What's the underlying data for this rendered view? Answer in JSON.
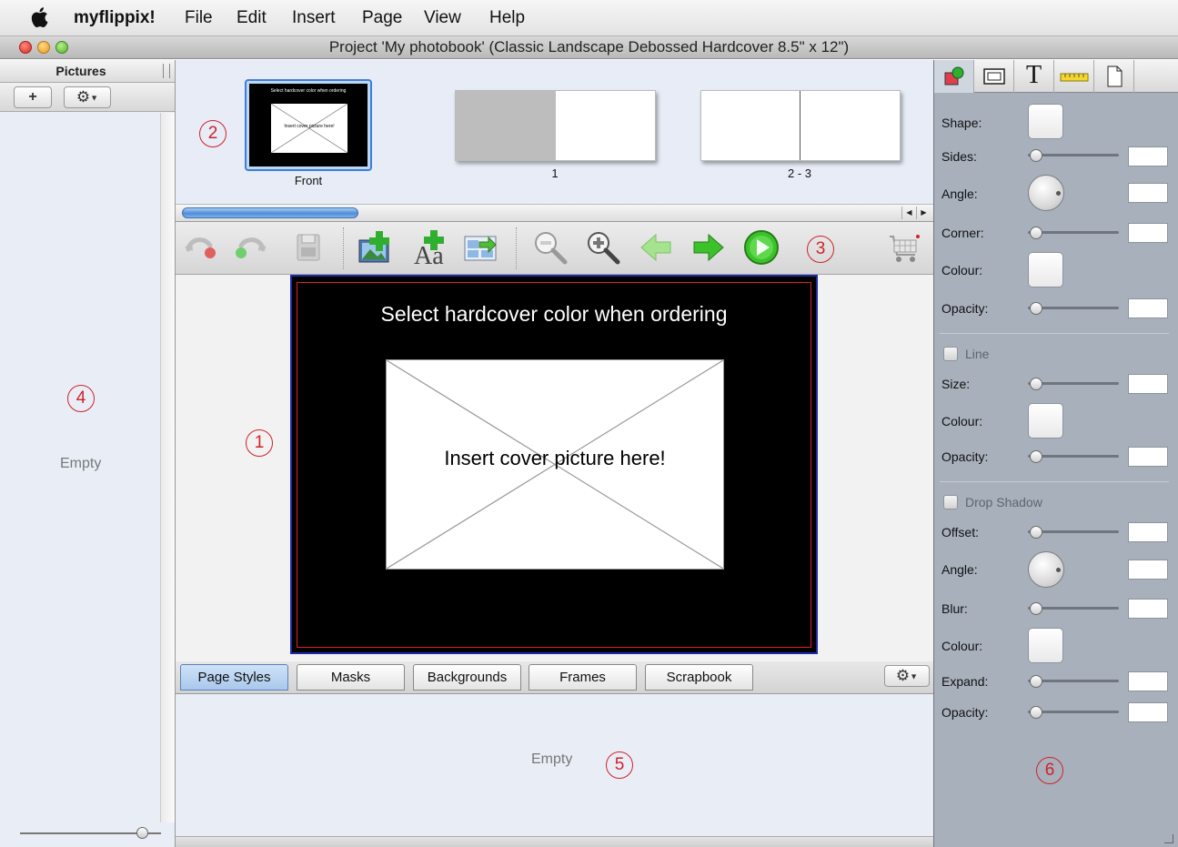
{
  "menubar": {
    "apple_icon": "apple-icon",
    "app_name": "myflippix!",
    "items": [
      "File",
      "Edit",
      "Insert",
      "Page",
      "View",
      "Help"
    ]
  },
  "window": {
    "title": "Project 'My photobook' (Classic Landscape Debossed Hardcover 8.5\" x 12\")"
  },
  "pictures_panel": {
    "header": "Pictures",
    "add_label": "+",
    "empty_text": "Empty",
    "callout": "4"
  },
  "thumbnails": {
    "callout": "2",
    "items": [
      {
        "label": "Front",
        "mini_title": "Select hardcover color when ordering",
        "mini_text": "Insert cover picture here!"
      },
      {
        "label": "1"
      },
      {
        "label": "2 - 3"
      }
    ]
  },
  "toolbar": {
    "callout": "3",
    "icons": [
      "undo-icon",
      "redo-icon",
      "save-icon",
      "add-picture-icon",
      "add-text-icon",
      "import-icon",
      "zoom-out-icon",
      "zoom-in-icon",
      "previous-page-icon",
      "next-page-icon",
      "play-icon",
      "cart-icon"
    ]
  },
  "canvas": {
    "callout": "1",
    "cover_title": "Select hardcover color when ordering",
    "placeholder_text": "Insert cover picture here!"
  },
  "tabs": [
    "Page Styles",
    "Masks",
    "Backgrounds",
    "Frames",
    "Scrapbook"
  ],
  "styles_area": {
    "empty_text": "Empty",
    "callout": "5"
  },
  "inspector": {
    "callout": "6",
    "tab_icons": [
      "shape-tool-icon",
      "frame-tool-icon",
      "text-tool-icon",
      "ruler-tool-icon",
      "page-tool-icon"
    ],
    "labels": {
      "shape": "Shape:",
      "sides": "Sides:",
      "angle": "Angle:",
      "corner": "Corner:",
      "colour": "Colour:",
      "opacity": "Opacity:",
      "line": "Line",
      "size": "Size:",
      "line_colour": "Colour:",
      "line_opacity": "Opacity:",
      "drop_shadow": "Drop Shadow",
      "offset": "Offset:",
      "shadow_angle": "Angle:",
      "blur": "Blur:",
      "shadow_colour": "Colour:",
      "expand": "Expand:",
      "shadow_opacity": "Opacity:"
    }
  },
  "colors": {
    "accent_blue": "#3f7fd4",
    "callout_red": "#d0222a",
    "cover_black": "#000000",
    "inspector_bg": "#a8b0bb"
  }
}
